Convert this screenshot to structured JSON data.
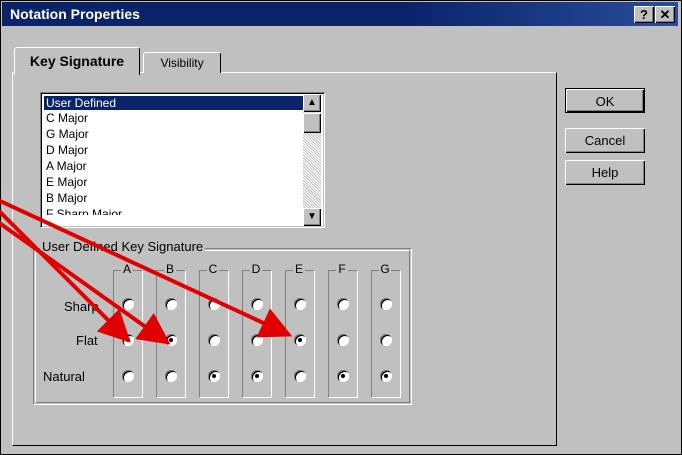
{
  "window": {
    "title": "Notation Properties",
    "help_btn": "?",
    "close_btn": "✕"
  },
  "tabs": [
    {
      "label": "Key Signature",
      "active": true
    },
    {
      "label": "Visibility",
      "active": false
    }
  ],
  "key_list": {
    "items": [
      "User Defined",
      "C Major",
      "G Major",
      "D Major",
      "A Major",
      "E Major",
      "B Major",
      "F Sharp Major"
    ],
    "selected": "User Defined"
  },
  "buttons": {
    "ok": "OK",
    "cancel": "Cancel",
    "help": "Help"
  },
  "group": {
    "title": "User Defined Key Signature",
    "columns": [
      "A",
      "B",
      "C",
      "D",
      "E",
      "F",
      "G"
    ],
    "rows": [
      "Sharp",
      "Flat",
      "Natural"
    ],
    "selected": [
      "Flat",
      "Flat",
      "Natural",
      "Natural",
      "Flat",
      "Natural",
      "Natural"
    ]
  },
  "colors": {
    "titlebar": "#0a246a",
    "face": "#c0c0c0",
    "annotation_arrow": "#e00000"
  }
}
